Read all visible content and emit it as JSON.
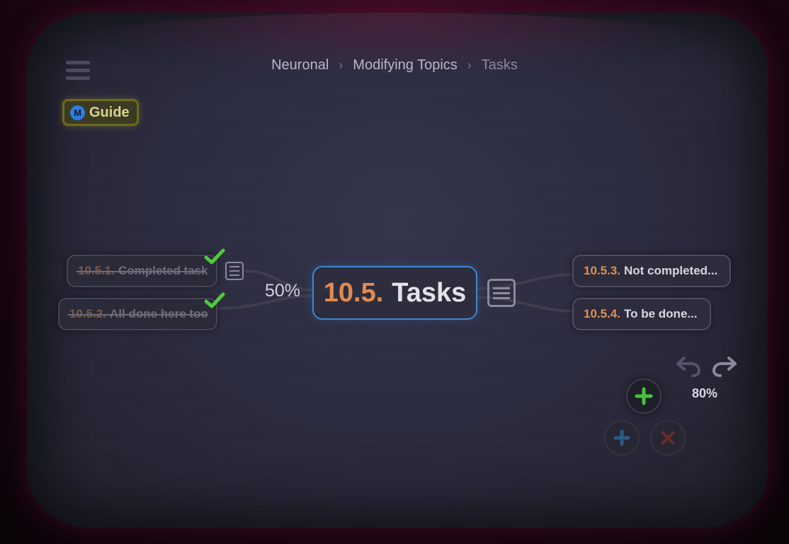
{
  "breadcrumb": {
    "items": [
      "Neuronal",
      "Modifying Topics"
    ],
    "current": "Tasks",
    "separator": "›"
  },
  "guide": {
    "badge": "M",
    "label": "Guide"
  },
  "center_topic": {
    "number": "10.5.",
    "title": "Tasks",
    "progress": "50%"
  },
  "subtopics": [
    {
      "number": "10.5.1.",
      "title": "Completed task",
      "completed": true,
      "has_note": true
    },
    {
      "number": "10.5.2.",
      "title": "All done here too",
      "completed": true,
      "has_note": false
    },
    {
      "number": "10.5.3.",
      "title": "Not completed...",
      "completed": false,
      "has_note": false
    },
    {
      "number": "10.5.4.",
      "title": "To be done...",
      "completed": false,
      "has_note": false
    }
  ],
  "zoom": "80%",
  "icons": [
    "menu-icon",
    "check-icon",
    "note-icon",
    "undo-icon",
    "redo-icon",
    "plus-icon",
    "close-icon"
  ],
  "colors": {
    "accent_orange": "#e09055",
    "center_border": "#3f86d3",
    "check_green": "#4ec93a",
    "guide_border": "#6e6a1c",
    "guide_text": "#d8d48a"
  }
}
